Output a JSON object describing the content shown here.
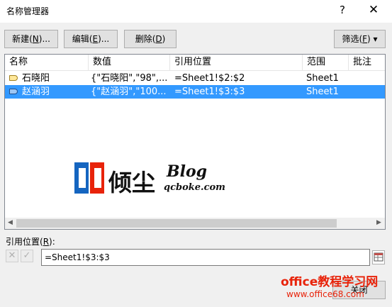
{
  "window": {
    "title": "名称管理器",
    "help": "?",
    "close": "✕"
  },
  "toolbar": {
    "new_label": "新建(",
    "new_key": "N",
    "new_tail": ")...",
    "edit_label": "编辑(",
    "edit_key": "E",
    "edit_tail": ")...",
    "delete_label": "删除(",
    "delete_key": "D",
    "delete_tail": ")",
    "filter_label": "筛选(",
    "filter_key": "F",
    "filter_tail": ") ▾"
  },
  "table": {
    "columns": [
      "名称",
      "数值",
      "引用位置",
      "范围",
      "批注"
    ],
    "rows": [
      {
        "name": "石晓阳",
        "value": "{\"石晓阳\",\"98\",...",
        "ref": "=Sheet1!$2:$2",
        "scope": "Sheet1",
        "comment": "",
        "selected": false
      },
      {
        "name": "赵涵羽",
        "value": "{\"赵涵羽\",\"100...",
        "ref": "=Sheet1!$3:$3",
        "scope": "Sheet1",
        "comment": "",
        "selected": true
      }
    ]
  },
  "refers_to": {
    "label": "引用位置(",
    "key": "R",
    "tail": "):",
    "value": "=Sheet1!$3:$3",
    "cancel_glyph": "✕",
    "ok_glyph": "✓"
  },
  "footer": {
    "close_label": "关闭"
  },
  "watermark": {
    "brand": "倾尘",
    "blog": "Blog",
    "domain": "qcboke.com",
    "site_name": "office教程学习网",
    "site_url": "www.office68.com"
  },
  "colors": {
    "selection": "#3399ff",
    "watermark_red": "#e8230a"
  }
}
